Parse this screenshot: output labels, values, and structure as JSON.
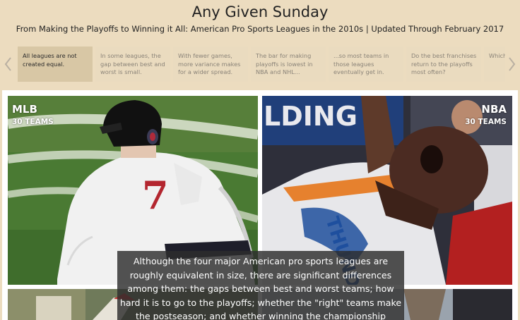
{
  "header": {
    "title": "Any Given Sunday",
    "subtitle": "From Making the Playoffs to Winning it All: American Pro Sports Leagues in the 2010s | Updated Through February 2017"
  },
  "story_points": [
    "All leagues are not created equal.",
    "In some leagues, the gap between best and worst is small.",
    "With fewer games, more variance makes for a wider spread.",
    "The bar for making playoffs is lowest in NBA and NHL...",
    "...so most teams in those leagues eventually get in.",
    "Do the best franchises return to the playoffs most often?",
    "Which have chan"
  ],
  "story_active_index": 0,
  "tiles": {
    "mlb": {
      "league": "MLB",
      "teams": "30 TEAMS",
      "jersey_number": "7"
    },
    "nba": {
      "league": "NBA",
      "teams": "30 TEAMS",
      "sign_text": "LDING",
      "jersey_text": "THUNDER"
    }
  },
  "caption": "Although the four major American pro sports leagues are roughly equivalent in size, there are significant differences among them: the gaps between best and worst teams; how hard it is to go to the playoffs; whether the \"right\" teams make the postseason; and whether winning the championship",
  "icons": {
    "prev": "chevron-left-icon",
    "next": "chevron-right-icon"
  },
  "colors": {
    "background": "#ecdcbf",
    "active_story": "#d8c7a5",
    "caption_bg": "#2d2d2d"
  }
}
